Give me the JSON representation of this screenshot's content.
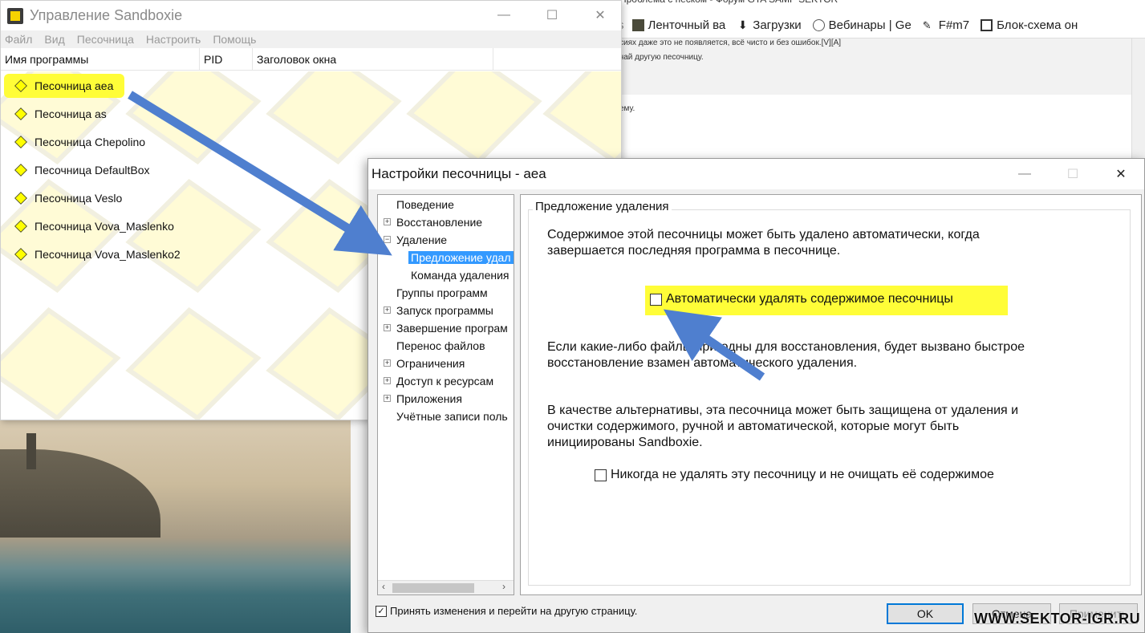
{
  "background_browser": {
    "page_title": "Проблема с песком - Форум GTA SAMP SEKTOR",
    "bookmarks": [
      {
        "label": "Ленточный ва",
        "icon": "image-icon"
      },
      {
        "label": "Загрузки",
        "icon": "download-icon"
      },
      {
        "label": "Вебинары | Ge",
        "icon": "globe-icon"
      },
      {
        "label": "F#m7",
        "icon": "pen-icon"
      },
      {
        "label": "Блок-схема он",
        "icon": "diagram-icon"
      }
    ],
    "post_lines": [
      "сиях даже это не появляется, всё чисто и без ошибок.[V][A]",
      "чай другую песочницу.",
      "ему."
    ]
  },
  "sandboxie": {
    "title": "Управление Sandboxie",
    "menu": [
      "Файл",
      "Вид",
      "Песочница",
      "Настроить",
      "Помощь"
    ],
    "columns": [
      "Имя программы",
      "PID",
      "Заголовок окна"
    ],
    "rows": [
      "Песочница aea",
      "Песочница as",
      "Песочница Chepolino",
      "Песочница DefaultBox",
      "Песочница Veslo",
      "Песочница Vova_Maslenko",
      "Песочница Vova_Maslenko2"
    ]
  },
  "dialog": {
    "title": "Настройки песочницы - aea",
    "tree": [
      {
        "label": "Поведение",
        "expander": ""
      },
      {
        "label": "Восстановление",
        "expander": "+"
      },
      {
        "label": "Удаление",
        "expander": "−"
      },
      {
        "label": "Предложение удал",
        "expander": "",
        "selected": true
      },
      {
        "label": "Команда удаления",
        "expander": ""
      },
      {
        "label": "Группы программ",
        "expander": ""
      },
      {
        "label": "Запуск программы",
        "expander": "+"
      },
      {
        "label": "Завершение програм",
        "expander": "+"
      },
      {
        "label": "Перенос файлов",
        "expander": ""
      },
      {
        "label": "Ограничения",
        "expander": "+"
      },
      {
        "label": "Доступ к ресурсам",
        "expander": "+"
      },
      {
        "label": "Приложения",
        "expander": "+"
      },
      {
        "label": "Учётные записи поль",
        "expander": ""
      }
    ],
    "group_title": "Предложение удаления",
    "para1_line1": "Содержимое этой песочницы может быть удалено автоматически, когда",
    "para1_line2": "завершается последняя программа в песочнице.",
    "auto_delete_label": "Автоматически удалять содержимое песочницы",
    "auto_delete_checked": false,
    "para2_line1": "Если какие-либо файлы пригодны для восстановления, будет вызвано быстрое",
    "para2_line2": "восстановление взамен автоматического удаления.",
    "para3_line1": "В качестве альтернативы, эта песочница может быть защищена от удаления и",
    "para3_line2": "очистки содержимого, ручной и автоматической, которые могут быть",
    "para3_line3": "инициированы Sandboxie.",
    "never_delete_label": "Никогда не удалять эту песочницу и не очищать её содержимое",
    "never_delete_checked": false,
    "accept_label": "Принять изменения и перейти на другую страницу.",
    "accept_checked": true,
    "ok_label": "OK",
    "cancel_label": "Отмена",
    "apply_label": "Применить"
  },
  "watermark": "WWW.SEKTOR-IGR.RU",
  "colors": {
    "highlight": "#fffd38",
    "arrow": "#4f7fcf",
    "selection": "#3399ff",
    "ok_border": "#0078d7"
  }
}
